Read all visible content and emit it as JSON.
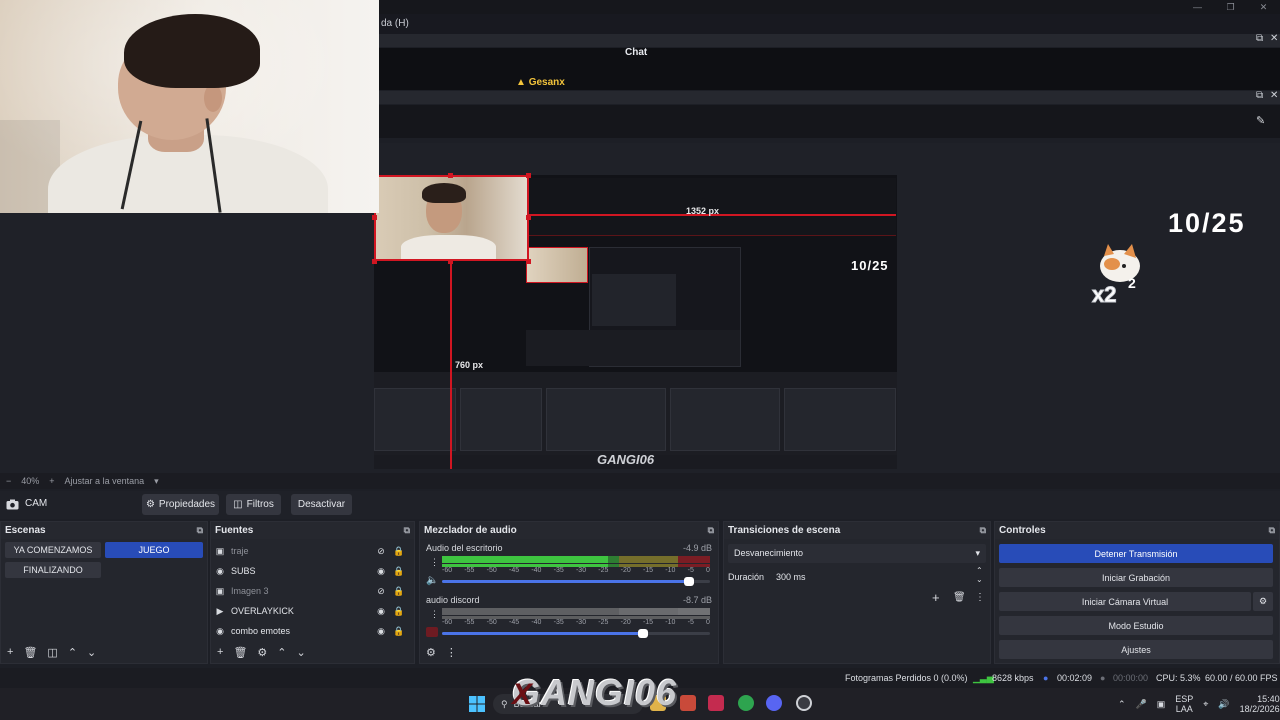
{
  "menu": {
    "help_fragment": "da (H)"
  },
  "chat": {
    "title": "Chat",
    "username": "Gesanx"
  },
  "preview": {
    "dim_horizontal": "1352 px",
    "dim_vertical": "760 px",
    "counter": "10/25",
    "nested_counter": "10/25",
    "zoom": "40%",
    "fit_label": "Ajustar a la ventana"
  },
  "scene_toolbar": {
    "source_name": "CAM",
    "properties": "Propiedades",
    "filters": "Filtros",
    "deactivate": "Desactivar"
  },
  "scenes": {
    "title": "Escenas",
    "items": [
      {
        "label": "YA COMENZAMOS",
        "active": false
      },
      {
        "label": "JUEGO",
        "active": true
      },
      {
        "label": "FINALIZANDO",
        "active": false
      }
    ]
  },
  "sources": {
    "title": "Fuentes",
    "items": [
      {
        "label": "traje",
        "icon": "image-icon",
        "visible": false
      },
      {
        "label": "SUBS",
        "icon": "globe-icon",
        "visible": true
      },
      {
        "label": "Imagen 3",
        "icon": "image-icon",
        "visible": false
      },
      {
        "label": "OVERLAYKICK",
        "icon": "play-icon",
        "visible": true
      },
      {
        "label": "combo emotes",
        "icon": "globe-icon",
        "visible": true
      }
    ]
  },
  "mixer": {
    "title": "Mezclador de audio",
    "tracks": [
      {
        "name": "Audio del escritorio",
        "db": "-4.9 dB",
        "level": 0.62,
        "volume": 0.92,
        "muted": false
      },
      {
        "name": "audio discord",
        "db": "-8.7 dB",
        "level": 0.0,
        "volume": 0.75,
        "muted": true
      }
    ],
    "scale": [
      "-60",
      "-55",
      "-50",
      "-45",
      "-40",
      "-35",
      "-30",
      "-25",
      "-20",
      "-15",
      "-10",
      "-5",
      "0"
    ]
  },
  "transitions": {
    "title": "Transiciones de escena",
    "selected": "Desvanecimiento",
    "duration_label": "Duración",
    "duration_value": "300 ms"
  },
  "controls": {
    "title": "Controles",
    "buttons": [
      {
        "label": "Detener Transmisión",
        "primary": true
      },
      {
        "label": "Iniciar Grabación",
        "primary": false
      },
      {
        "label": "Iniciar Cámara Virtual",
        "primary": false
      },
      {
        "label": "Modo Estudio",
        "primary": false
      },
      {
        "label": "Ajustes",
        "primary": false
      }
    ]
  },
  "status": {
    "dropped_frames": "Fotogramas Perdidos 0 (0.0%)",
    "bitrate": "8628 kbps",
    "stream_time": "00:02:09",
    "rec_time": "00:00:00",
    "cpu": "CPU: 5.3%",
    "fps": "60.00 / 60.00 FPS"
  },
  "taskbar": {
    "search_placeholder": "Buscar",
    "overlay_logo": "GANGI06",
    "overlay_logo_prefix": "X",
    "lang_top": "ESP",
    "lang_bottom": "LAA",
    "time": "15:40",
    "date": "18/2/2026"
  },
  "colors": {
    "accent": "#284cb8",
    "selection_red": "#d11622",
    "meter_green": "#3ec440",
    "bg": "#1d1f26"
  }
}
